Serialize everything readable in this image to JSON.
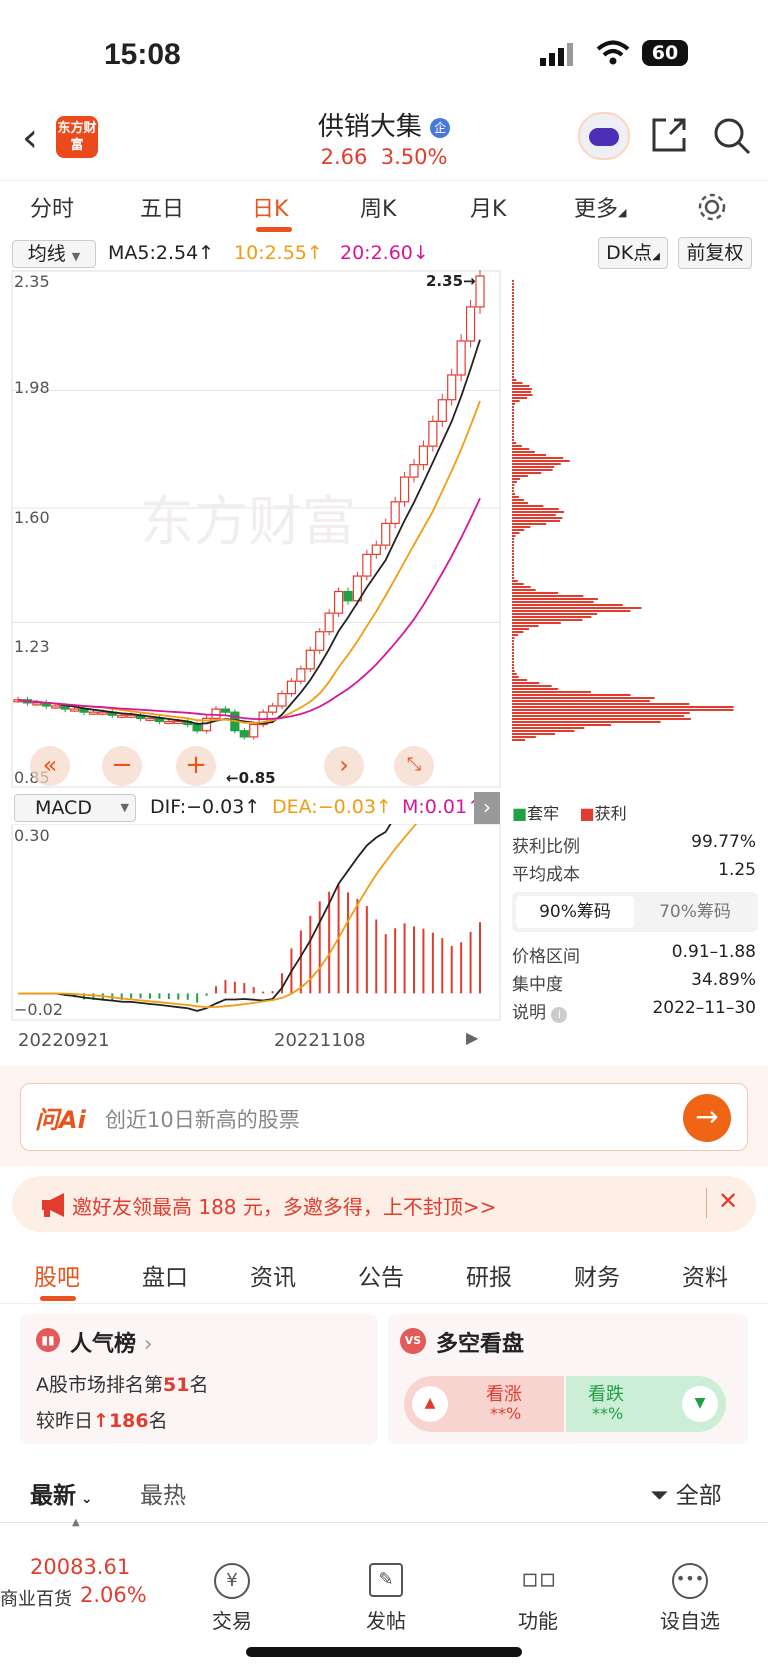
{
  "status": {
    "time": "15:08",
    "battery": "60"
  },
  "header": {
    "logo_text": "东方财富",
    "title": "供销大集",
    "title_badge": "企",
    "price": "2.66",
    "change_pct": "3.50%"
  },
  "tabs": [
    "分时",
    "五日",
    "日K",
    "周K",
    "月K",
    "更多"
  ],
  "active_tab": "日K",
  "ma_bar": {
    "type": "均线",
    "ma5": "MA5:2.54↑",
    "ma10": "10:2.55↑",
    "ma20": "20:2.60↓",
    "dk": "DK点",
    "adjust": "前复权"
  },
  "price_axis": {
    "top": "2.35",
    "l1": "1.98",
    "l2": "1.60",
    "l3": "1.23",
    "bottom": "0.85"
  },
  "price_markers": {
    "high": "2.35→",
    "low": "←0.85"
  },
  "watermark": "东方财富",
  "macd_bar": {
    "name": "MACD",
    "dif": "DIF:−0.03↑",
    "dea": "DEA:−0.03↑",
    "m": "M:0.01↑"
  },
  "macd_axis": {
    "top": "0.30",
    "bottom": "−0.02"
  },
  "dates": {
    "start": "20220921",
    "mid": "20221108"
  },
  "chips": {
    "legend_trapped": "套牢",
    "legend_profit": "获利",
    "rows": [
      {
        "label": "获利比例",
        "value": "99.77%"
      },
      {
        "label": "平均成本",
        "value": "1.25"
      }
    ],
    "tab90": "90%筹码",
    "tab70": "70%筹码",
    "rows2": [
      {
        "label": "价格区间",
        "value": "0.91–1.88"
      },
      {
        "label": "集中度",
        "value": "34.89%"
      },
      {
        "label": "说明",
        "value": "2022–11–30"
      }
    ]
  },
  "ask": {
    "logo": "问Ai",
    "placeholder": "创近10日新高的股票"
  },
  "banner": {
    "text": "邀好友领最高 188 元，多邀多得，上不封顶>>"
  },
  "subtabs": [
    "股吧",
    "盘口",
    "资讯",
    "公告",
    "研报",
    "财务",
    "资料"
  ],
  "popularity": {
    "title": "人气榜",
    "line1_pre": "A股市场排名第",
    "line1_num": "51",
    "line1_post": "名",
    "line2_pre": "较昨日",
    "line2_num": "186",
    "line2_post": "名"
  },
  "vote": {
    "title": "多空看盘",
    "up": "看涨",
    "up_val": "**%",
    "down": "看跌",
    "down_val": "**%"
  },
  "feed": {
    "latest": "最新",
    "hot": "最热",
    "filter": "全部"
  },
  "bottom": {
    "index_value": "20083.61",
    "index_name": "商业百货",
    "index_pct": "2.06%",
    "trade": "交易",
    "post": "发帖",
    "func": "功能",
    "watch": "设自选"
  },
  "colors": {
    "accent": "#e8541c",
    "up": "#e23c2e",
    "down": "#22a046"
  },
  "chart_data": {
    "type": "candlestick",
    "title": "",
    "ylim": [
      0.85,
      2.35
    ],
    "ma5_last": 2.54,
    "ma10_last": 2.55,
    "ma20_last": 2.6,
    "close_series_approx": [
      0.98,
      0.97,
      0.97,
      0.96,
      0.96,
      0.95,
      0.95,
      0.94,
      0.94,
      0.94,
      0.93,
      0.93,
      0.93,
      0.92,
      0.92,
      0.91,
      0.91,
      0.91,
      0.9,
      0.88,
      0.92,
      0.95,
      0.94,
      0.88,
      0.86,
      0.9,
      0.94,
      0.96,
      1.0,
      1.04,
      1.08,
      1.14,
      1.2,
      1.26,
      1.33,
      1.3,
      1.38,
      1.45,
      1.48,
      1.55,
      1.62,
      1.7,
      1.74,
      1.8,
      1.88,
      1.95,
      2.03,
      2.14,
      2.25,
      2.35
    ]
  }
}
